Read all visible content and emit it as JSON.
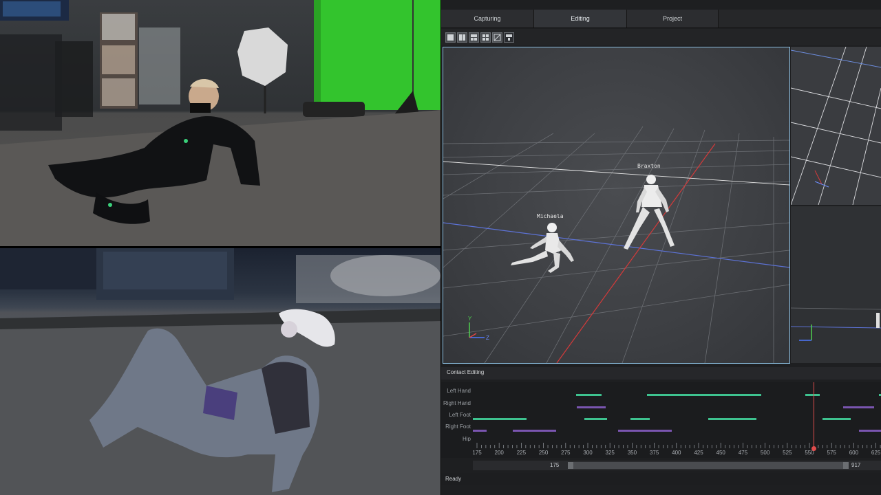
{
  "tabs": [
    {
      "label": "Capturing",
      "active": false
    },
    {
      "label": "Editing",
      "active": true
    },
    {
      "label": "Project",
      "active": false
    }
  ],
  "toolbar_icons": [
    "single-view-icon",
    "two-view-icon",
    "three-view-icon",
    "four-view-icon",
    "custom-layout-icon",
    "split-view-icon"
  ],
  "viewport": {
    "characters": [
      {
        "name": "Michaela"
      },
      {
        "name": "Braxton"
      }
    ],
    "axis_labels": {
      "y": "Y",
      "z": "Z"
    }
  },
  "contact_editing": {
    "title": "Contact Editing",
    "tracks": [
      {
        "label": "Left Hand"
      },
      {
        "label": "Right Hand"
      },
      {
        "label": "Left Foot"
      },
      {
        "label": "Right Foot"
      },
      {
        "label": "Hip"
      }
    ],
    "colors": {
      "contact_green": "#3ec28f",
      "contact_purple": "#7a55b0",
      "playhead": "#e04c4c"
    },
    "timeline_ticks": [
      "175",
      "200",
      "225",
      "250",
      "275",
      "300",
      "325",
      "350",
      "375",
      "400",
      "425",
      "450",
      "475",
      "500",
      "525",
      "550",
      "575",
      "600",
      "625"
    ],
    "current_frame_marker": 555,
    "range_start": "175",
    "range_end": "917"
  },
  "status": "Ready"
}
